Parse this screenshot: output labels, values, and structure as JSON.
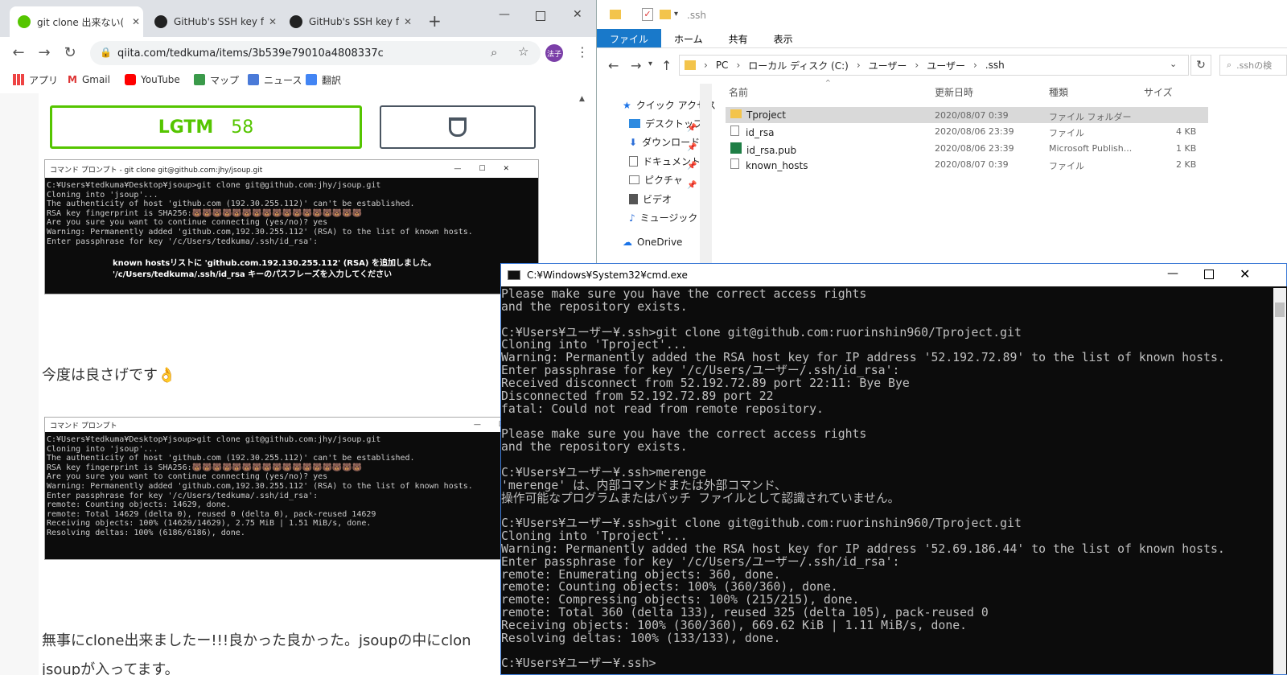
{
  "chrome": {
    "tabs": [
      {
        "label": "git clone 出来ない( /",
        "active": true
      },
      {
        "label": "GitHub's SSH key fi",
        "active": false
      },
      {
        "label": "GitHub's SSH key fi",
        "active": false
      }
    ],
    "new_tab": "+",
    "url": "qiita.com/tedkuma/items/3b539e79010a4808337c",
    "avatar": "法子",
    "bookmarks": [
      "アプリ",
      "Gmail",
      "YouTube",
      "マップ",
      "ニュース",
      "翻訳"
    ],
    "lgtm": {
      "label": "LGTM",
      "count": "58"
    },
    "screenshot1": {
      "title": "コマンド プロンプト - git  clone git@github.com:jhy/jsoup.git",
      "lines": [
        "C:¥Users¥tedkuma¥Desktop¥jsoup>git clone git@github.com:jhy/jsoup.git",
        "Cloning into 'jsoup'...",
        "The authenticity of host 'github.com (192.30.255.112)' can't be established.",
        "RSA key fingerprint is SHA256:🐻🐻🐻🐻🐻🐻🐻🐻🐻🐻🐻🐻🐻🐻🐻🐻🐻",
        "Are you sure you want to continue connecting (yes/no)? yes",
        "Warning: Permanently added 'github.com,192.30.255.112' (RSA) to the list of known hosts.",
        "Enter passphrase for key '/c/Users/tedkuma/.ssh/id_rsa':"
      ],
      "annotation1": "known hostsリストに 'github.com.192.130.255.112' (RSA) を追加しました。",
      "annotation2": "'/c/Users/tedkuma/.ssh/id_rsa   キーのパスフレーズを入力してください"
    },
    "text1": "今度は良さげです👌",
    "screenshot2": {
      "title": "コマンド プロンプト",
      "lines": [
        "C:¥Users¥tedkuma¥Desktop¥jsoup>git clone git@github.com:jhy/jsoup.git",
        "Cloning into 'jsoup'...",
        "The authenticity of host 'github.com (192.30.255.112)' can't be established.",
        "RSA key fingerprint is SHA256:🐻🐻🐻🐻🐻🐻🐻🐻🐻🐻🐻🐻🐻🐻🐻🐻🐻",
        "Are you sure you want to continue connecting (yes/no)? yes",
        "Warning: Permanently added 'github.com,192.30.255.112' (RSA) to the list of known hosts.",
        "Enter passphrase for key '/c/Users/tedkuma/.ssh/id_rsa':",
        "remote: Counting objects: 14629, done.",
        "remote: Total 14629 (delta 0), reused 0 (delta 0), pack-reused 14629",
        "Receiving objects: 100% (14629/14629), 2.75 MiB | 1.51 MiB/s, done.",
        "Resolving deltas: 100% (6186/6186), done."
      ]
    },
    "text2": "無事にclone出来ましたー!!!良かった良かった。jsoupの中にclon",
    "text3": "jsoupが入ってます。"
  },
  "explorer": {
    "qat_path": ".ssh",
    "ribbon_tabs": [
      "ファイル",
      "ホーム",
      "共有",
      "表示"
    ],
    "breadcrumb": [
      "PC",
      "ローカル ディスク (C:)",
      "ユーザー",
      "ユーザー",
      ".ssh"
    ],
    "search_placeholder": ".sshの検",
    "nav": [
      "クイック アクセス",
      "デスクトップ",
      "ダウンロード",
      "ドキュメント",
      "ピクチャ",
      "ビデオ",
      "ミュージック",
      "OneDrive"
    ],
    "columns": [
      "名前",
      "更新日時",
      "種類",
      "サイズ"
    ],
    "files": [
      {
        "name": "Tproject",
        "date": "2020/08/07 0:39",
        "type": "ファイル フォルダー",
        "size": ""
      },
      {
        "name": "id_rsa",
        "date": "2020/08/06 23:39",
        "type": "ファイル",
        "size": "4 KB"
      },
      {
        "name": "id_rsa.pub",
        "date": "2020/08/06 23:39",
        "type": "Microsoft Publish...",
        "size": "1 KB"
      },
      {
        "name": "known_hosts",
        "date": "2020/08/07 0:39",
        "type": "ファイル",
        "size": "2 KB"
      }
    ]
  },
  "cmd": {
    "title": "C:¥Windows¥System32¥cmd.exe",
    "lines": [
      "Please make sure you have the correct access rights",
      "and the repository exists.",
      "",
      "C:¥Users¥ユーザー¥.ssh>git clone git@github.com:ruorinshin960/Tproject.git",
      "Cloning into 'Tproject'...",
      "Warning: Permanently added the RSA host key for IP address '52.192.72.89' to the list of known hosts.",
      "Enter passphrase for key '/c/Users/ユーザー/.ssh/id_rsa':",
      "Received disconnect from 52.192.72.89 port 22:11: Bye Bye",
      "Disconnected from 52.192.72.89 port 22",
      "fatal: Could not read from remote repository.",
      "",
      "Please make sure you have the correct access rights",
      "and the repository exists.",
      "",
      "C:¥Users¥ユーザー¥.ssh>merenge",
      "'merenge' は、内部コマンドまたは外部コマンド、",
      "操作可能なプログラムまたはバッチ ファイルとして認識されていません。",
      "",
      "C:¥Users¥ユーザー¥.ssh>git clone git@github.com:ruorinshin960/Tproject.git",
      "Cloning into 'Tproject'...",
      "Warning: Permanently added the RSA host key for IP address '52.69.186.44' to the list of known hosts.",
      "Enter passphrase for key '/c/Users/ユーザー/.ssh/id_rsa':",
      "remote: Enumerating objects: 360, done.",
      "remote: Counting objects: 100% (360/360), done.",
      "remote: Compressing objects: 100% (215/215), done.",
      "remote: Total 360 (delta 133), reused 325 (delta 105), pack-reused 0",
      "Receiving objects: 100% (360/360), 669.62 KiB | 1.11 MiB/s, done.",
      "Resolving deltas: 100% (133/133), done.",
      "",
      "C:¥Users¥ユーザー¥.ssh>"
    ]
  }
}
